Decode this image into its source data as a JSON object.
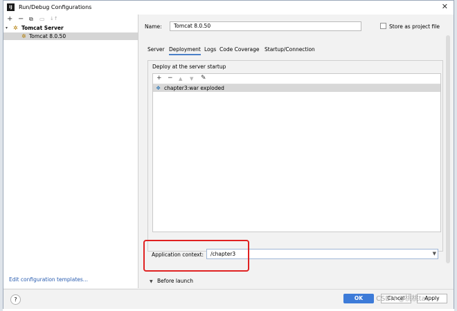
{
  "window": {
    "title": "Run/Debug Configurations",
    "close_glyph": "✕"
  },
  "app_icon": {
    "text": "IJ"
  },
  "left_toolbar": [
    "+",
    "−",
    "⧉",
    "▭",
    "↓↑"
  ],
  "tree": {
    "group_arrow": "▾",
    "group_icon": "tomcat-icon",
    "group_label": "Tomcat Server",
    "item_icon": "tomcat-icon",
    "item_label": "Tomcat 8.0.50"
  },
  "edit_templates_link": "Edit configuration templates...",
  "name_field": {
    "label": "Name:",
    "value": "Tomcat 8.0.50"
  },
  "store_as_project_file": {
    "label": "Store as project file",
    "checked": false
  },
  "tabs": [
    {
      "label": "Server",
      "active": false
    },
    {
      "label": "Deployment",
      "active": true
    },
    {
      "label": "Logs",
      "active": false
    },
    {
      "label": "Code Coverage",
      "active": false
    },
    {
      "label": "Startup/Connection",
      "active": false
    }
  ],
  "deploy": {
    "title": "Deploy at the server startup",
    "toolbar": [
      "+",
      "−",
      "▲",
      "▼",
      "✎"
    ],
    "artifact_icon": "artifact-icon",
    "artifacts": [
      "chapter3:war exploded"
    ]
  },
  "app_context": {
    "label": "Application context:",
    "value": "/chapter3"
  },
  "before_launch": {
    "arrow": "▼",
    "label": "Before launch"
  },
  "buttons": {
    "help": "?",
    "ok": "OK",
    "cancel": "Cancel",
    "apply": "Apply"
  },
  "watermark": "CSDN @桃桃tao",
  "colors": {
    "ok_button": "#3d7bd8",
    "highlight_box": "#e02020",
    "active_tab_underline": "#4a7fc8",
    "link": "#2a5db0"
  }
}
